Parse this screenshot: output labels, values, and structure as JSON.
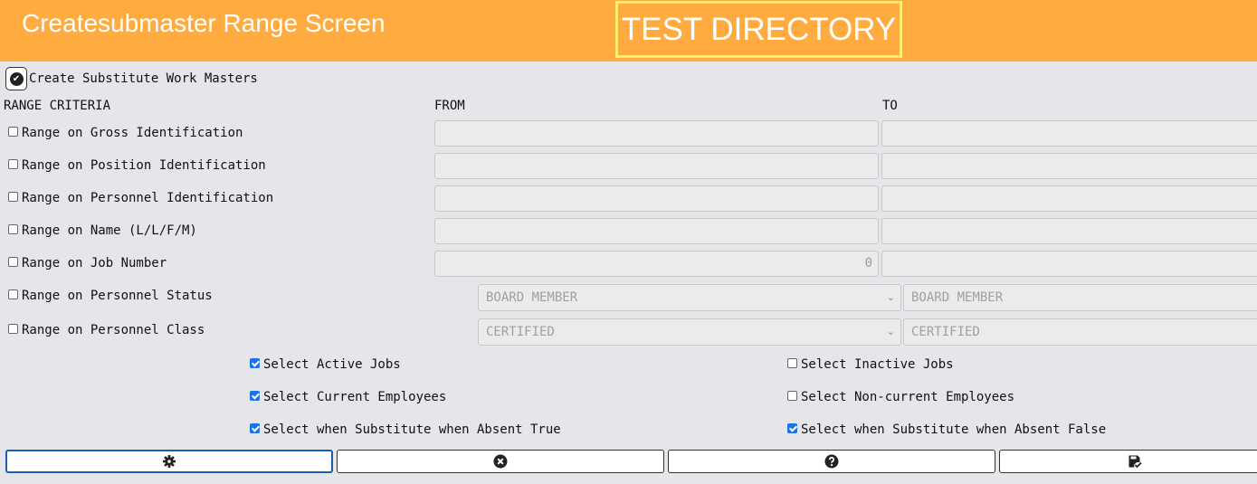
{
  "header": {
    "title": "Createsubmaster Range Screen",
    "environment": "TEST DIRECTORY"
  },
  "create_toggle": {
    "label": "Create Substitute Work Masters",
    "checked": true
  },
  "columns": {
    "criteria": "RANGE CRITERIA",
    "from": "FROM",
    "to": "TO"
  },
  "ranges": [
    {
      "label": "Range on Gross Identification",
      "checked": false,
      "from": "",
      "to": ""
    },
    {
      "label": "Range on Position Identification",
      "checked": false,
      "from": "",
      "to": ""
    },
    {
      "label": "Range on Personnel Identification",
      "checked": false,
      "from": "",
      "to": ""
    },
    {
      "label": "Range on Name (L/L/F/M)",
      "checked": false,
      "from": "",
      "to": ""
    },
    {
      "label": "Range on Job Number",
      "checked": false,
      "from": "0",
      "to": ""
    },
    {
      "label": "Range on Personnel Status",
      "checked": false,
      "from": "BOARD MEMBER",
      "to": "BOARD MEMBER"
    },
    {
      "label": "Range on Personnel Class",
      "checked": false,
      "from": "CERTIFIED",
      "to": "CERTIFIED"
    }
  ],
  "options": {
    "active_jobs": {
      "label": "Select Active Jobs",
      "checked": true
    },
    "inactive_jobs": {
      "label": "Select Inactive Jobs",
      "checked": false
    },
    "current_employees": {
      "label": "Select Current Employees",
      "checked": true
    },
    "noncurrent_employees": {
      "label": "Select Non-current Employees",
      "checked": false
    },
    "sub_absent_true": {
      "label": "Select when Substitute when Absent True",
      "checked": true
    },
    "sub_absent_false": {
      "label": "Select when Substitute when Absent False",
      "checked": true
    }
  },
  "toolbar": {
    "icons": [
      "gear-icon",
      "close-circle-icon",
      "help-circle-icon",
      "save-check-icon"
    ]
  },
  "colors": {
    "header": "#ffab40",
    "badge_border": "#fff06a",
    "checkbox": "#1a73e8",
    "background": "#e5e5ea"
  }
}
